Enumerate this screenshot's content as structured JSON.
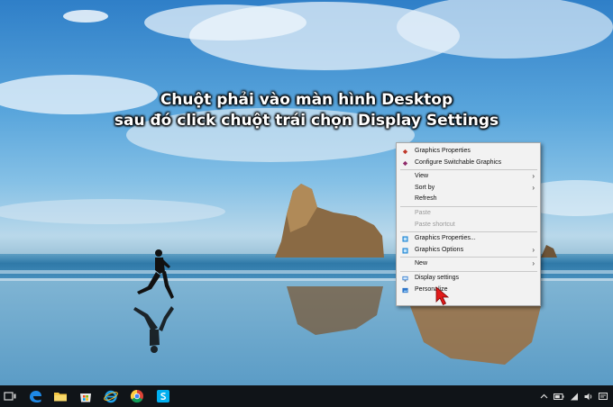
{
  "headline": {
    "line1": "Chuột phải vào màn hình Desktop",
    "line2": "sau đó click chuột trái chọn Display Settings"
  },
  "context_menu": {
    "graphics_properties_top": "Graphics Properties",
    "configure_switchable_graphics": "Configure Switchable Graphics",
    "view": "View",
    "sort_by": "Sort by",
    "refresh": "Refresh",
    "paste": "Paste",
    "paste_shortcut": "Paste shortcut",
    "graphics_properties": "Graphics Properties...",
    "graphics_options": "Graphics Options",
    "new": "New",
    "display_settings": "Display settings",
    "personalize": "Personalize",
    "submenu_arrow": "›"
  },
  "colors": {
    "menu_background": "#f2f2f2",
    "taskbar": "#101418",
    "cursor": "#e11b1b"
  },
  "taskbar_icons": [
    "task-view-icon",
    "edge-icon",
    "file-explorer-icon",
    "store-icon",
    "internet-explorer-icon",
    "chrome-icon",
    "skype-icon"
  ],
  "tray_icons": [
    "show-hidden-icons",
    "battery-icon",
    "network-icon",
    "volume-icon",
    "action-center-icon"
  ]
}
